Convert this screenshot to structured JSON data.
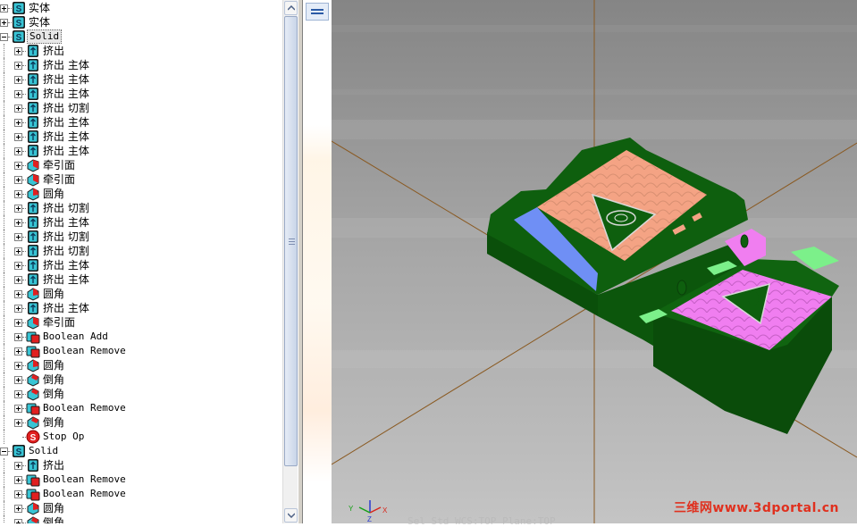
{
  "tree": {
    "items": [
      {
        "label": "实体",
        "icon": "solid-icon",
        "depth": 0,
        "expander": "plus"
      },
      {
        "label": "实体",
        "icon": "solid-icon",
        "depth": 0,
        "expander": "plus"
      },
      {
        "label": "Solid",
        "icon": "solid-icon",
        "depth": 0,
        "expander": "minus",
        "selected": true,
        "mono": true
      },
      {
        "label": "挤出",
        "icon": "extrude-icon",
        "depth": 1,
        "expander": "plus"
      },
      {
        "label": "挤出 主体",
        "icon": "extrude-icon",
        "depth": 1,
        "expander": "plus"
      },
      {
        "label": "挤出 主体",
        "icon": "extrude-icon",
        "depth": 1,
        "expander": "plus"
      },
      {
        "label": "挤出 主体",
        "icon": "extrude-icon",
        "depth": 1,
        "expander": "plus"
      },
      {
        "label": "挤出 切割",
        "icon": "extrude-icon",
        "depth": 1,
        "expander": "plus"
      },
      {
        "label": "挤出 主体",
        "icon": "extrude-icon",
        "depth": 1,
        "expander": "plus"
      },
      {
        "label": "挤出 主体",
        "icon": "extrude-icon",
        "depth": 1,
        "expander": "plus"
      },
      {
        "label": "挤出 主体",
        "icon": "extrude-icon",
        "depth": 1,
        "expander": "plus"
      },
      {
        "label": "牵引面",
        "icon": "draft-face-icon",
        "depth": 1,
        "expander": "plus"
      },
      {
        "label": "牵引面",
        "icon": "draft-face-icon",
        "depth": 1,
        "expander": "plus"
      },
      {
        "label": "圆角",
        "icon": "fillet-icon",
        "depth": 1,
        "expander": "plus"
      },
      {
        "label": "挤出 切割",
        "icon": "extrude-icon",
        "depth": 1,
        "expander": "plus"
      },
      {
        "label": "挤出 主体",
        "icon": "extrude-icon",
        "depth": 1,
        "expander": "plus"
      },
      {
        "label": "挤出 切割",
        "icon": "extrude-icon",
        "depth": 1,
        "expander": "plus"
      },
      {
        "label": "挤出 切割",
        "icon": "extrude-icon",
        "depth": 1,
        "expander": "plus"
      },
      {
        "label": "挤出 主体",
        "icon": "extrude-icon",
        "depth": 1,
        "expander": "plus"
      },
      {
        "label": "挤出 主体",
        "icon": "extrude-icon",
        "depth": 1,
        "expander": "plus"
      },
      {
        "label": "圆角",
        "icon": "fillet-icon",
        "depth": 1,
        "expander": "plus"
      },
      {
        "label": "挤出 主体",
        "icon": "extrude-icon",
        "depth": 1,
        "expander": "plus"
      },
      {
        "label": "牵引面",
        "icon": "draft-face-icon",
        "depth": 1,
        "expander": "plus"
      },
      {
        "label": "Boolean Add",
        "icon": "boolean-icon",
        "depth": 1,
        "expander": "plus",
        "mono": true
      },
      {
        "label": "Boolean Remove",
        "icon": "boolean-icon",
        "depth": 1,
        "expander": "plus",
        "mono": true
      },
      {
        "label": "圆角",
        "icon": "fillet-icon",
        "depth": 1,
        "expander": "plus"
      },
      {
        "label": "倒角",
        "icon": "chamfer-icon",
        "depth": 1,
        "expander": "plus"
      },
      {
        "label": "倒角",
        "icon": "chamfer-icon",
        "depth": 1,
        "expander": "plus"
      },
      {
        "label": "Boolean Remove",
        "icon": "boolean-icon",
        "depth": 1,
        "expander": "plus",
        "mono": true
      },
      {
        "label": "倒角",
        "icon": "chamfer-icon",
        "depth": 1,
        "expander": "plus"
      },
      {
        "label": "Stop Op",
        "icon": "stop-icon",
        "depth": 1,
        "expander": "none",
        "mono": true
      },
      {
        "label": "Solid",
        "icon": "solid-icon",
        "depth": 0,
        "expander": "minus",
        "mono": true
      },
      {
        "label": "挤出",
        "icon": "extrude-icon",
        "depth": 1,
        "expander": "plus"
      },
      {
        "label": "Boolean Remove",
        "icon": "boolean-icon",
        "depth": 1,
        "expander": "plus",
        "mono": true
      },
      {
        "label": "Boolean Remove",
        "icon": "boolean-icon",
        "depth": 1,
        "expander": "plus",
        "mono": true
      },
      {
        "label": "圆角",
        "icon": "fillet-icon",
        "depth": 1,
        "expander": "plus"
      },
      {
        "label": "倒角",
        "icon": "chamfer-icon",
        "depth": 1,
        "expander": "plus"
      }
    ]
  },
  "viewport": {
    "background_top": "#858585",
    "background_bottom": "#c4c4c4",
    "model_color": "#0b5c0b",
    "face_peach": "#f4a384",
    "face_pink": "#f07ef0",
    "face_blue": "#6f8ff5",
    "face_light_green": "#7cf08a",
    "axis_color": "#8a5a22"
  },
  "triad": {
    "x_label": "X",
    "y_label": "Y",
    "z_label": "Z",
    "x_color": "#d8261a",
    "y_color": "#16a016",
    "z_color": "#2a3ad0"
  },
  "watermark": "三维网www.3dportal.cn",
  "status_ghost": "Sel Std  WCS:TOP  Plane:TOP"
}
